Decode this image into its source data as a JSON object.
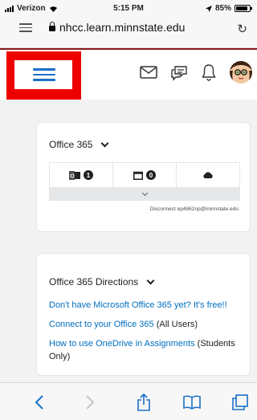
{
  "status_bar": {
    "carrier": "Verizon",
    "time": "5:15 PM",
    "battery": "85%"
  },
  "browser": {
    "url": "nhcc.learn.minnstate.edu"
  },
  "navbar": {
    "icons": [
      "menu-icon",
      "mail-icon",
      "chat-icon",
      "bell-icon",
      "avatar"
    ]
  },
  "office365_widget": {
    "title": "Office 365",
    "mail_count": "1",
    "calendar_count": "0",
    "disconnect_text": "Disconnect ep4862np@minnstate.edu"
  },
  "directions_widget": {
    "title": "Office 365 Directions",
    "link1": "Don't have Microsoft Office 365 yet? It's free!!",
    "link2": "Connect to your Office 365",
    "link2_suffix": " (All Users)",
    "link3": "How to use OneDrive in Assignments",
    "link3_suffix": " (Students Only)"
  },
  "colors": {
    "accent": "#006fbf",
    "highlight": "#ee0000",
    "nav_border": "#8b1a1a"
  }
}
